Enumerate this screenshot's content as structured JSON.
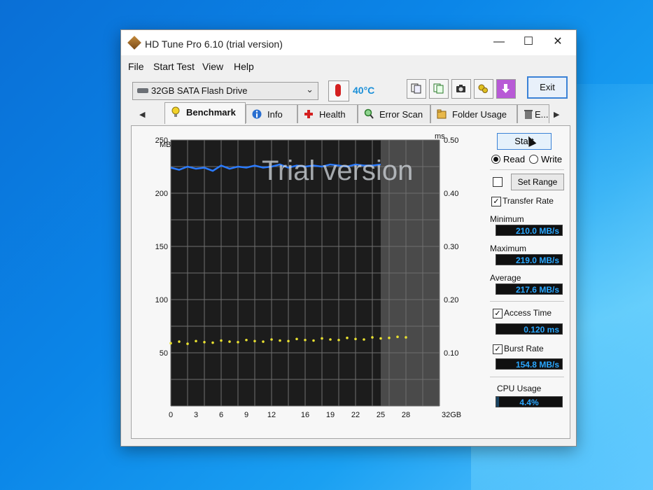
{
  "window": {
    "title": "HD Tune Pro 6.10 (trial version)",
    "controls": {
      "minimize": "—",
      "maximize": "☐",
      "close": "✕"
    }
  },
  "menu": [
    "File",
    "Start Test",
    "View",
    "Help"
  ],
  "toolbar": {
    "drive": "32GB SATA Flash Drive",
    "temperature": "40°C",
    "tools": [
      "copy-text-icon",
      "copy-info-icon",
      "camera-icon",
      "options-icon",
      "save-down-icon"
    ],
    "exit_label": "Exit"
  },
  "tabs": [
    {
      "label": "Benchmark",
      "icon": "lightbulb-icon",
      "active": true
    },
    {
      "label": "Info",
      "icon": "info-icon",
      "active": false
    },
    {
      "label": "Health",
      "icon": "health-cross-icon",
      "active": false
    },
    {
      "label": "Error Scan",
      "icon": "magnifier-icon",
      "active": false
    },
    {
      "label": "Folder Usage",
      "icon": "folder-icon",
      "active": false
    },
    {
      "label": "E...",
      "icon": "trash-icon",
      "active": false
    }
  ],
  "benchmark": {
    "watermark": "Trial version",
    "start_label": "Start",
    "read_label": "Read",
    "write_label": "Write",
    "read_selected": true,
    "set_range_label": "Set Range",
    "transfer_rate_label": "Transfer Rate",
    "minimum_label": "Minimum",
    "minimum_value": "210.0 MB/s",
    "maximum_label": "Maximum",
    "maximum_value": "219.0 MB/s",
    "average_label": "Average",
    "average_value": "217.6 MB/s",
    "access_time_label": "Access Time",
    "access_time_value": "0.120 ms",
    "burst_rate_label": "Burst Rate",
    "burst_rate_value": "154.8 MB/s",
    "cpu_usage_label": "CPU Usage",
    "cpu_usage_value": "4.4%",
    "cpu_usage_fraction": 0.044
  },
  "chart_data": {
    "type": "line",
    "y_left_label": "MB/s",
    "y_right_label": "ms",
    "x_unit_label": "32GB",
    "y_left_ticks": [
      "250",
      "200",
      "150",
      "100",
      "50"
    ],
    "y_left_range": [
      0,
      250
    ],
    "y_right_ticks": [
      "0.50",
      "0.40",
      "0.30",
      "0.20",
      "0.10"
    ],
    "y_right_range": [
      0,
      0.5
    ],
    "x_ticks": [
      "0",
      "3",
      "6",
      "9",
      "12",
      "16",
      "19",
      "22",
      "25",
      "28"
    ],
    "x_range": [
      0,
      32
    ],
    "tested_until": 25,
    "grid": true,
    "series": [
      {
        "color": "#2b7bff",
        "x": [
          0,
          1,
          2,
          3,
          4,
          5,
          6,
          7,
          8,
          9,
          10,
          11,
          12,
          13,
          14,
          15,
          16,
          17,
          18,
          19,
          20,
          21,
          22,
          23,
          24,
          25
        ],
        "y": [
          224,
          222,
          225,
          223,
          224,
          221,
          226,
          223,
          225,
          224,
          226,
          224,
          225,
          227,
          224,
          226,
          225,
          226,
          225,
          227,
          226,
          225,
          227,
          226,
          226,
          227
        ]
      },
      {
        "color": "#e8e030",
        "x": [
          0,
          1,
          2,
          3,
          4,
          5,
          6,
          7,
          8,
          9,
          10,
          11,
          12,
          13,
          14,
          15,
          16,
          17,
          18,
          19,
          20,
          21,
          22,
          23,
          24,
          25,
          26,
          27,
          28
        ],
        "y": [
          0.118,
          0.121,
          0.117,
          0.122,
          0.12,
          0.119,
          0.123,
          0.121,
          0.12,
          0.124,
          0.122,
          0.121,
          0.125,
          0.123,
          0.122,
          0.126,
          0.124,
          0.123,
          0.127,
          0.125,
          0.124,
          0.128,
          0.126,
          0.125,
          0.129,
          0.127,
          0.128,
          0.13,
          0.129
        ]
      }
    ]
  },
  "colors": {
    "accent": "#3b82d6",
    "temp": "#1a8fd8",
    "stat_text": "#2aa7ff",
    "plot_bg": "#1c1c1c"
  }
}
